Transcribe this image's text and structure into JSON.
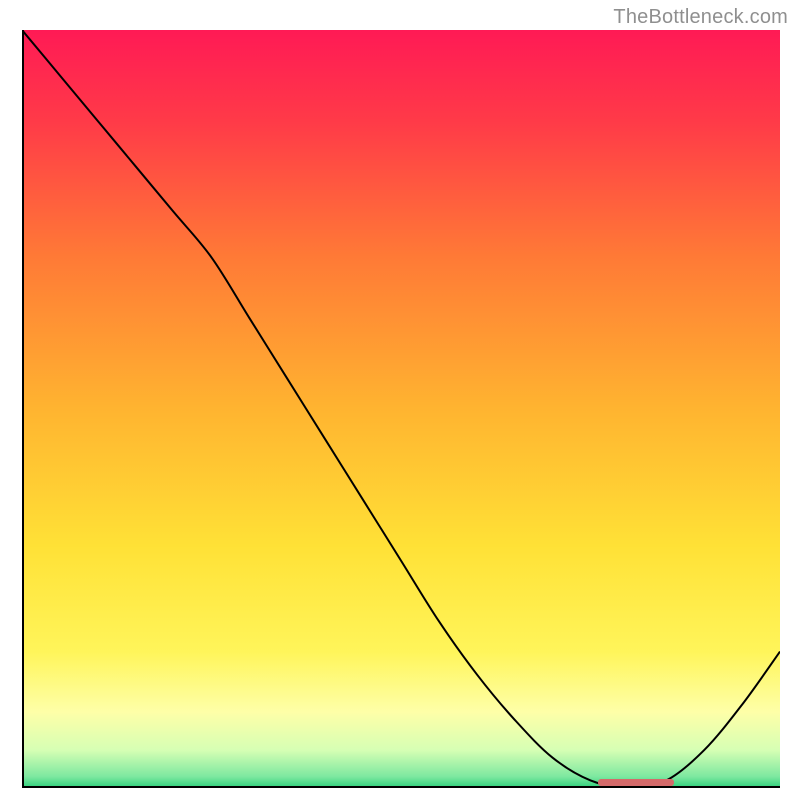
{
  "watermark": "TheBottleneck.com",
  "chart_data": {
    "type": "line",
    "title": "",
    "xlabel": "",
    "ylabel": "",
    "xlim": [
      0,
      100
    ],
    "ylim": [
      0,
      100
    ],
    "x": [
      0,
      5,
      10,
      15,
      20,
      25,
      30,
      35,
      40,
      45,
      50,
      55,
      60,
      65,
      70,
      75,
      80,
      85,
      90,
      95,
      100
    ],
    "values": [
      100,
      94,
      88,
      82,
      76,
      70,
      62,
      54,
      46,
      38,
      30,
      22,
      15,
      9,
      4,
      1,
      0,
      1,
      5,
      11,
      18
    ],
    "minimum_band": {
      "x_start": 76,
      "x_end": 86
    },
    "gradient": {
      "type": "vertical",
      "stops": [
        {
          "pos": 0.0,
          "color": "#ff1a55"
        },
        {
          "pos": 0.12,
          "color": "#ff3a48"
        },
        {
          "pos": 0.3,
          "color": "#ff7a36"
        },
        {
          "pos": 0.5,
          "color": "#ffb430"
        },
        {
          "pos": 0.68,
          "color": "#ffe136"
        },
        {
          "pos": 0.82,
          "color": "#fff55a"
        },
        {
          "pos": 0.9,
          "color": "#feffa8"
        },
        {
          "pos": 0.95,
          "color": "#d6ffb4"
        },
        {
          "pos": 0.985,
          "color": "#7de8a0"
        },
        {
          "pos": 1.0,
          "color": "#2ccf7a"
        }
      ]
    }
  }
}
